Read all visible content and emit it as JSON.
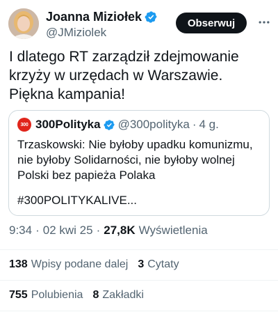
{
  "author": {
    "display_name": "Joanna Miziołek",
    "handle": "@JMiziolek"
  },
  "follow_label": "Obserwuj",
  "tweet": {
    "text": "I dlatego RT zarządził zdejmowanie\nkrzyży w urzędach w Warszawie.\nPiękna kampania!"
  },
  "quote": {
    "avatar_text": "300",
    "name": "300Polityka",
    "handle": "@300polityka",
    "separator": "·",
    "time": "4 g.",
    "text": "Trzaskowski: Nie byłoby upadku komunizmu, nie byłoby Solidarności, nie byłoby wolnej Polski bez papieża Polaka",
    "hashtag": "#300POLITYKALIVE..."
  },
  "meta": {
    "time": "9:34",
    "date": "02 kwi 25",
    "separator": "·",
    "views_count": "27,8K",
    "views_label": "Wyświetlenia"
  },
  "stats": {
    "reposts_count": "138",
    "reposts_label": "Wpisy podane dalej",
    "quotes_count": "3",
    "quotes_label": "Cytaty",
    "likes_count": "755",
    "likes_label": "Polubienia",
    "bookmarks_count": "8",
    "bookmarks_label": "Zakładki"
  },
  "icons": {
    "verified": "verified-badge-icon",
    "more": "more-options-icon"
  },
  "colors": {
    "verified_blue": "#1d9bf0",
    "follow_button_bg": "#0f1419",
    "quote_avatar_red": "#e0251b",
    "secondary_text": "#536471"
  }
}
